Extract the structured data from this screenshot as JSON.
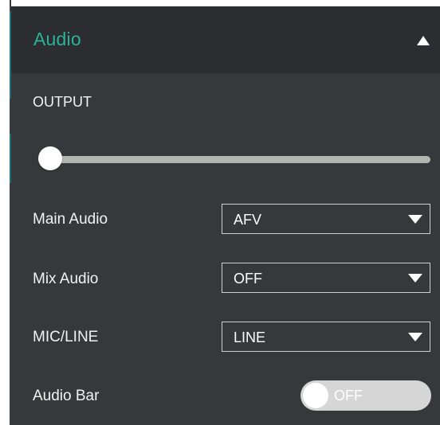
{
  "panel": {
    "title": "Audio",
    "collapse_icon": "caret-up-icon"
  },
  "output": {
    "label": "OUTPUT",
    "level_fraction": 0.0
  },
  "rows": {
    "main_audio": {
      "label": "Main Audio",
      "value": "AFV"
    },
    "mix_audio": {
      "label": "Mix Audio",
      "value": "OFF"
    },
    "mic_line": {
      "label": "MIC/LINE",
      "value": "LINE"
    },
    "audio_bar": {
      "label": "Audio Bar",
      "state": "OFF"
    }
  },
  "colors": {
    "accent": "#2bb39a",
    "panel_bg": "#36383b",
    "header_bg": "#2b2d30"
  }
}
